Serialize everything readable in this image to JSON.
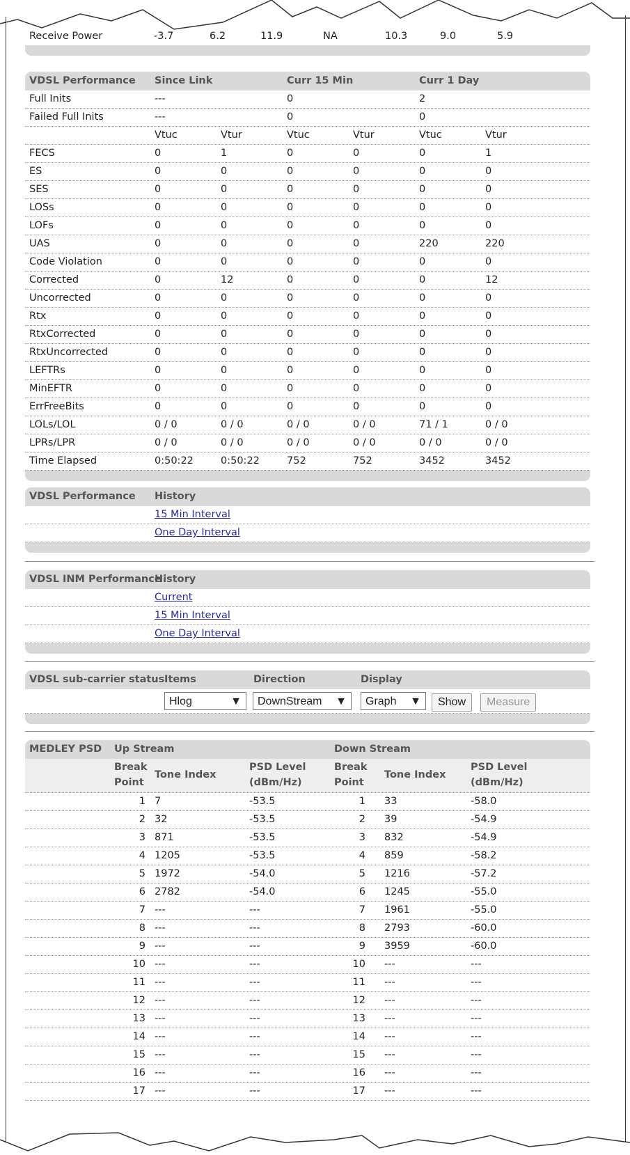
{
  "receive_power": {
    "label": "Receive Power",
    "values": [
      "-3.7",
      "6.2",
      "11.9",
      "NA",
      "10.3",
      "9.0",
      "5.9"
    ]
  },
  "vdsl_perf": {
    "headers": [
      "VDSL Performance",
      "Since Link",
      "Curr 15 Min",
      "Curr 1 Day"
    ],
    "full_inits": {
      "label": "Full Inits",
      "values": [
        "---",
        "0",
        "2"
      ]
    },
    "failed_full_inits": {
      "label": "Failed Full Inits",
      "values": [
        "---",
        "0",
        "0"
      ]
    },
    "subheaders": [
      "Vtuc",
      "Vtur",
      "Vtuc",
      "Vtur",
      "Vtuc",
      "Vtur"
    ],
    "rows": [
      {
        "label": "FECS",
        "values": [
          "0",
          "1",
          "0",
          "0",
          "0",
          "1"
        ]
      },
      {
        "label": "ES",
        "values": [
          "0",
          "0",
          "0",
          "0",
          "0",
          "0"
        ]
      },
      {
        "label": "SES",
        "values": [
          "0",
          "0",
          "0",
          "0",
          "0",
          "0"
        ]
      },
      {
        "label": "LOSs",
        "values": [
          "0",
          "0",
          "0",
          "0",
          "0",
          "0"
        ]
      },
      {
        "label": "LOFs",
        "values": [
          "0",
          "0",
          "0",
          "0",
          "0",
          "0"
        ]
      },
      {
        "label": "UAS",
        "values": [
          "0",
          "0",
          "0",
          "0",
          "220",
          "220"
        ]
      },
      {
        "label": "Code Violation",
        "values": [
          "0",
          "0",
          "0",
          "0",
          "0",
          "0"
        ]
      },
      {
        "label": "Corrected",
        "values": [
          "0",
          "12",
          "0",
          "0",
          "0",
          "12"
        ]
      },
      {
        "label": "Uncorrected",
        "values": [
          "0",
          "0",
          "0",
          "0",
          "0",
          "0"
        ]
      },
      {
        "label": "Rtx",
        "values": [
          "0",
          "0",
          "0",
          "0",
          "0",
          "0"
        ]
      },
      {
        "label": "RtxCorrected",
        "values": [
          "0",
          "0",
          "0",
          "0",
          "0",
          "0"
        ]
      },
      {
        "label": "RtxUncorrected",
        "values": [
          "0",
          "0",
          "0",
          "0",
          "0",
          "0"
        ]
      },
      {
        "label": "LEFTRs",
        "values": [
          "0",
          "0",
          "0",
          "0",
          "0",
          "0"
        ]
      },
      {
        "label": "MinEFTR",
        "values": [
          "0",
          "0",
          "0",
          "0",
          "0",
          "0"
        ]
      },
      {
        "label": "ErrFreeBits",
        "values": [
          "0",
          "0",
          "0",
          "0",
          "0",
          "0"
        ]
      },
      {
        "label": "LOLs/LOL",
        "values": [
          "0 / 0",
          "0 / 0",
          "0 / 0",
          "0 / 0",
          "71 / 1",
          "0 / 0"
        ]
      },
      {
        "label": "LPRs/LPR",
        "values": [
          "0 / 0",
          "0 / 0",
          "0 / 0",
          "0 / 0",
          "0 / 0",
          "0 / 0"
        ]
      },
      {
        "label": "Time Elapsed",
        "values": [
          "0:50:22",
          "0:50:22",
          "752",
          "752",
          "3452",
          "3452"
        ]
      }
    ]
  },
  "vdsl_history": {
    "headers": [
      "VDSL Performance",
      "History"
    ],
    "links": [
      "15 Min Interval",
      "One Day Interval"
    ]
  },
  "inm_history": {
    "headers": [
      "VDSL INM Performance",
      "History"
    ],
    "links": [
      "Current",
      "15 Min Interval",
      "One Day Interval"
    ]
  },
  "subcarrier": {
    "headers": [
      "VDSL sub-carrier status",
      "Items",
      "Direction",
      "Display"
    ],
    "items_value": "Hlog",
    "direction_value": "DownStream",
    "display_value": "Graph",
    "show_label": "Show",
    "measure_label": "Measure"
  },
  "medley": {
    "headers": [
      "MEDLEY PSD",
      "Up Stream",
      "Down Stream"
    ],
    "sub": {
      "break1": "Break",
      "break2": "Point",
      "tone": "Tone Index",
      "psd1": "PSD Level",
      "psd2": "(dBm/Hz)"
    },
    "rows": [
      {
        "bp": "1",
        "up_tone": "7",
        "up_psd": "-53.5",
        "dn_tone": "33",
        "dn_psd": "-58.0"
      },
      {
        "bp": "2",
        "up_tone": "32",
        "up_psd": "-53.5",
        "dn_tone": "39",
        "dn_psd": "-54.9"
      },
      {
        "bp": "3",
        "up_tone": "871",
        "up_psd": "-53.5",
        "dn_tone": "832",
        "dn_psd": "-54.9"
      },
      {
        "bp": "4",
        "up_tone": "1205",
        "up_psd": "-53.5",
        "dn_tone": "859",
        "dn_psd": "-58.2"
      },
      {
        "bp": "5",
        "up_tone": "1972",
        "up_psd": "-54.0",
        "dn_tone": "1216",
        "dn_psd": "-57.2"
      },
      {
        "bp": "6",
        "up_tone": "2782",
        "up_psd": "-54.0",
        "dn_tone": "1245",
        "dn_psd": "-55.0"
      },
      {
        "bp": "7",
        "up_tone": "---",
        "up_psd": "---",
        "dn_tone": "1961",
        "dn_psd": "-55.0"
      },
      {
        "bp": "8",
        "up_tone": "---",
        "up_psd": "---",
        "dn_tone": "2793",
        "dn_psd": "-60.0"
      },
      {
        "bp": "9",
        "up_tone": "---",
        "up_psd": "---",
        "dn_tone": "3959",
        "dn_psd": "-60.0"
      },
      {
        "bp": "10",
        "up_tone": "---",
        "up_psd": "---",
        "dn_tone": "---",
        "dn_psd": "---"
      },
      {
        "bp": "11",
        "up_tone": "---",
        "up_psd": "---",
        "dn_tone": "---",
        "dn_psd": "---"
      },
      {
        "bp": "12",
        "up_tone": "---",
        "up_psd": "---",
        "dn_tone": "---",
        "dn_psd": "---"
      },
      {
        "bp": "13",
        "up_tone": "---",
        "up_psd": "---",
        "dn_tone": "---",
        "dn_psd": "---"
      },
      {
        "bp": "14",
        "up_tone": "---",
        "up_psd": "---",
        "dn_tone": "---",
        "dn_psd": "---"
      },
      {
        "bp": "15",
        "up_tone": "---",
        "up_psd": "---",
        "dn_tone": "---",
        "dn_psd": "---"
      },
      {
        "bp": "16",
        "up_tone": "---",
        "up_psd": "---",
        "dn_tone": "---",
        "dn_psd": "---"
      },
      {
        "bp": "17",
        "up_tone": "---",
        "up_psd": "---",
        "dn_tone": "---",
        "dn_psd": "---"
      }
    ]
  }
}
